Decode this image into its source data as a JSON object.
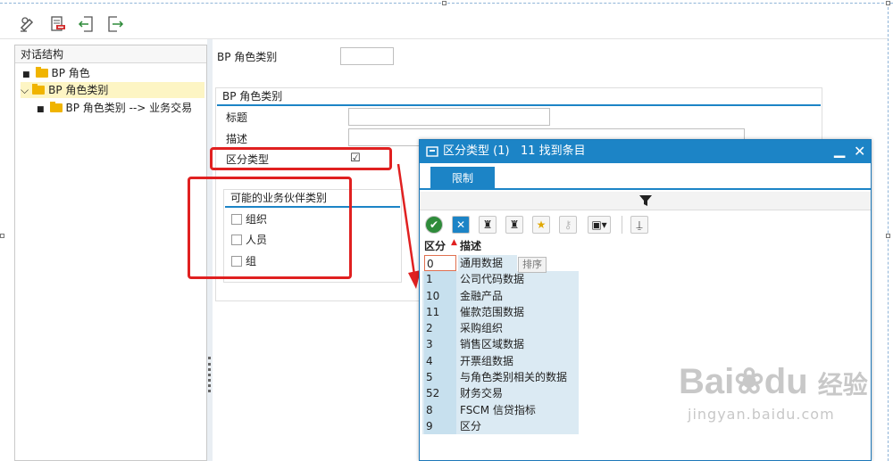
{
  "toolbar": {
    "icons": [
      "display-change-icon",
      "delete-icon",
      "previous-icon",
      "next-icon"
    ]
  },
  "tree": {
    "header": "对话结构",
    "items": [
      {
        "label": "BP 角色"
      },
      {
        "label": "BP 角色类别"
      },
      {
        "label": "BP 角色类别 --> 业务交易"
      }
    ]
  },
  "form": {
    "bp_role_category_label": "BP 角色类别",
    "group_title": "BP 角色类别",
    "title_label": "标题",
    "desc_label": "描述",
    "diff_type_label": "区分类型",
    "diff_type_checked": "☑",
    "partner_group_title": "可能的业务伙伴类别",
    "partner_options": [
      "组织",
      "人员",
      "组"
    ]
  },
  "popup": {
    "title": "区分类型 (1)   11 找到条目",
    "tab": "限制",
    "columns": [
      "区分",
      "描述"
    ],
    "tooltip": "排序",
    "rows": [
      {
        "code": "0",
        "desc": "通用数据"
      },
      {
        "code": "1",
        "desc": "公司代码数据"
      },
      {
        "code": "10",
        "desc": "金融产品"
      },
      {
        "code": "11",
        "desc": "催款范围数据"
      },
      {
        "code": "2",
        "desc": "采购组织"
      },
      {
        "code": "3",
        "desc": "销售区域数据"
      },
      {
        "code": "4",
        "desc": "开票组数据"
      },
      {
        "code": "5",
        "desc": "与角色类别相关的数据"
      },
      {
        "code": "52",
        "desc": "财务交易"
      },
      {
        "code": "8",
        "desc": "FSCM 信贷指标"
      },
      {
        "code": "9",
        "desc": "区分"
      }
    ]
  },
  "watermark": {
    "brand": "Bai",
    "brand2": "du",
    "cn": "经验",
    "url": "jingyan.baidu.com"
  },
  "colors": {
    "accent": "#1c84c6",
    "highlight": "#e02020",
    "folder": "#f0b400"
  }
}
